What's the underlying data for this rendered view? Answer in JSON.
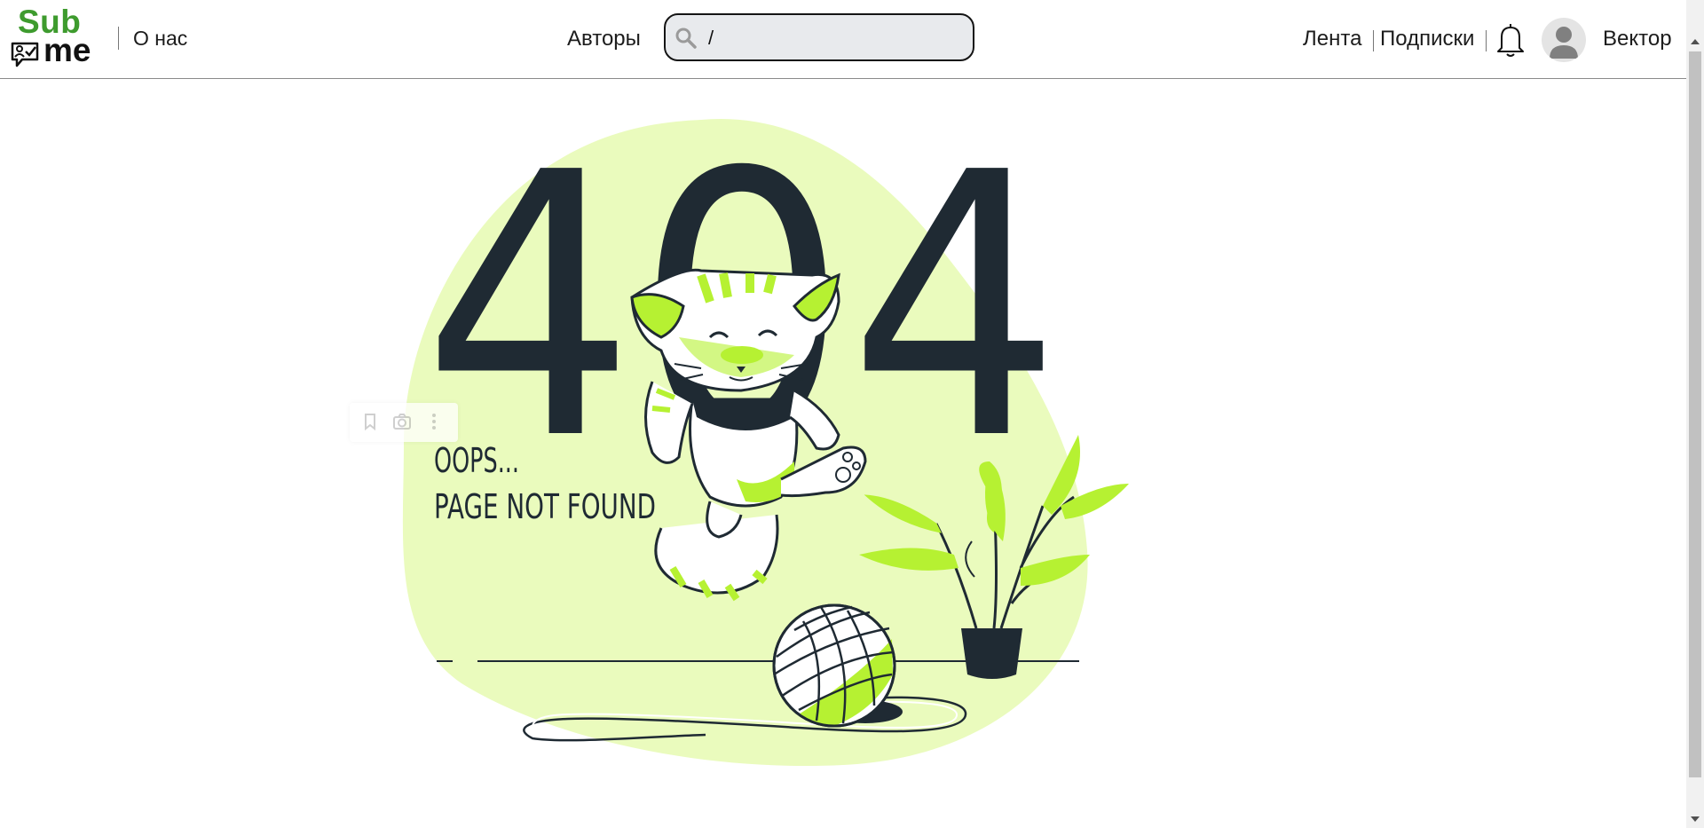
{
  "brand": {
    "line1": "Sub",
    "line2": "me"
  },
  "nav": {
    "about": "О нас",
    "authors": "Авторы",
    "feed": "Лента",
    "subscriptions": "Подписки",
    "username": "Вектор"
  },
  "search": {
    "value": "/",
    "icon": "search-icon"
  },
  "illustration": {
    "code": "404",
    "message_line1": "OOPS...",
    "message_line2": "PAGE NOT FOUND"
  },
  "colors": {
    "brand_green": "#3e9b2e",
    "blob": "#eafbbd",
    "lime": "#b6f132",
    "dark": "#1f2a33"
  },
  "icons": [
    "search-icon",
    "bell-icon",
    "avatar-icon",
    "bookmark-icon",
    "camera-icon",
    "more-icon"
  ]
}
